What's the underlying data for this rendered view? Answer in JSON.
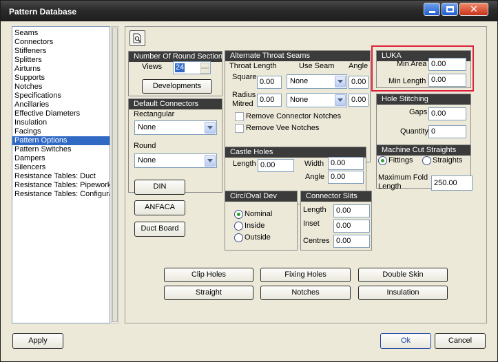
{
  "window": {
    "title": "Pattern Database"
  },
  "sidebar": {
    "items": [
      {
        "label": "Seams"
      },
      {
        "label": "Connectors"
      },
      {
        "label": "Stiffeners"
      },
      {
        "label": "Splitters"
      },
      {
        "label": "Airturns"
      },
      {
        "label": "Supports"
      },
      {
        "label": "Notches"
      },
      {
        "label": "Specifications"
      },
      {
        "label": "Ancillaries"
      },
      {
        "label": "Effective Diameters"
      },
      {
        "label": "Insulation"
      },
      {
        "label": "Facings"
      },
      {
        "label": "Pattern Options",
        "selected": true
      },
      {
        "label": "Pattern Switches"
      },
      {
        "label": "Dampers"
      },
      {
        "label": "Silencers"
      },
      {
        "label": "Resistance Tables: Duct"
      },
      {
        "label": "Resistance Tables: Pipework"
      },
      {
        "label": "Resistance Tables: Configura"
      }
    ]
  },
  "round_sections": {
    "title": "Number Of Round Sections",
    "views_label": "Views",
    "views_value": "24",
    "developments_label": "Developments"
  },
  "default_connectors": {
    "title": "Default Connectors",
    "rect_label": "Rectangular",
    "rect_value": "None",
    "round_label": "Round",
    "round_value": "None"
  },
  "side_buttons": {
    "din": "DIN",
    "anfaca": "ANFACA",
    "duct_board": "Duct Board"
  },
  "throat_seams": {
    "title": "Alternate Throat Seams",
    "throat_length_label": "Throat Length",
    "use_seam_label": "Use Seam",
    "angle_label": "Angle",
    "square_label": "Square",
    "square_value": "0.00",
    "square_seam": "None",
    "square_angle": "0.00",
    "radius_label": "Radius",
    "mitred_label": "Mitred",
    "radius_value": "0.00",
    "radius_seam": "None",
    "radius_angle": "0.00",
    "remove_connector": "Remove Connector Notches",
    "remove_vee": "Remove Vee Notches"
  },
  "luka": {
    "title": "LUKA",
    "min_area_label": "Min Area",
    "min_area_value": "0.00",
    "min_length_label": "Min Length",
    "min_length_value": "0.00"
  },
  "hole_stitching": {
    "title": "Hole Stitching",
    "gaps_label": "Gaps",
    "gaps_value": "0.00",
    "quantity_label": "Quantity",
    "quantity_value": "0"
  },
  "castle_holes": {
    "title": "Castle Holes",
    "length_label": "Length",
    "length_value": "0.00",
    "width_label": "Width",
    "width_value": "0.00",
    "angle_label": "Angle",
    "angle_value": "0.00"
  },
  "machine_cut": {
    "title": "Machine Cut Straights",
    "fittings": "Fittings",
    "straights": "Straights",
    "max_fold_label": "Maximum Fold Length",
    "max_fold_value": "250.00"
  },
  "circ_oval": {
    "title": "Circ/Oval Dev",
    "nominal": "Nominal",
    "inside": "Inside",
    "outside": "Outside"
  },
  "connector_slits": {
    "title": "Connector Slits",
    "length_label": "Length",
    "length_value": "0.00",
    "inset_label": "Inset",
    "inset_value": "0.00",
    "centres_label": "Centres",
    "centres_value": "0.00"
  },
  "bottom_buttons": {
    "clip_holes": "Clip Holes",
    "fixing_holes": "Fixing Holes",
    "double_skin": "Double Skin",
    "straight": "Straight",
    "notches": "Notches",
    "insulation": "Insulation"
  },
  "footer": {
    "apply": "Apply",
    "ok": "Ok",
    "cancel": "Cancel"
  }
}
